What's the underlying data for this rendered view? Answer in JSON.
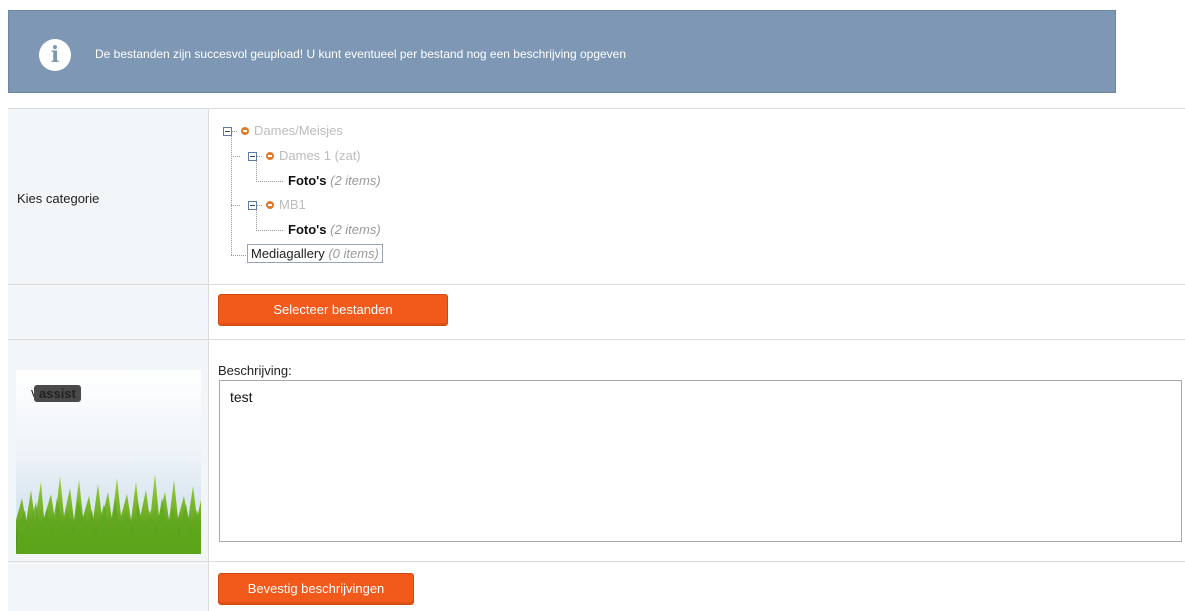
{
  "notice": {
    "icon": "info-icon",
    "message": "De bestanden zijn succesvol geupload! U kunt eventueel per bestand nog een beschrijving opgeven"
  },
  "category": {
    "label": "Kies categorie",
    "tree": {
      "root": "Dames/Meisjes",
      "child1": "Dames 1 (zat)",
      "child1_folder": "Foto's",
      "child1_count": "(2 items)",
      "child2": "MB1",
      "child2_folder": "Foto's",
      "child2_count": "(2 items)",
      "gallery": "Mediagallery",
      "gallery_count": "(0 items)"
    }
  },
  "select_files_label": "Selecteer bestanden",
  "description": {
    "label": "Beschrijving:",
    "value": "test",
    "logo_left": "voetbal",
    "logo_right": "assist"
  },
  "confirm_label": "Bevestig beschrijvingen",
  "colors": {
    "notice_bg": "#7d97b4",
    "button": "#f15a1a",
    "row_label_bg": "#f3f6f8"
  }
}
